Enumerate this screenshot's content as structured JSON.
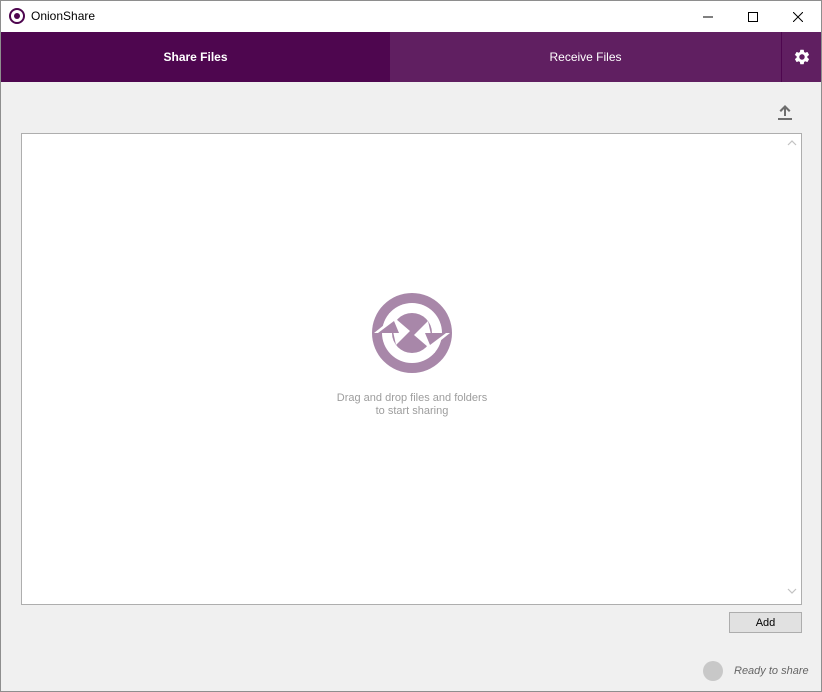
{
  "window": {
    "title": "OnionShare",
    "controls": [
      "minimize-icon",
      "maximize-icon",
      "close-icon"
    ]
  },
  "tabs": [
    {
      "label": "Share Files",
      "active": true
    },
    {
      "label": "Receive Files",
      "active": false
    }
  ],
  "toolbar": {
    "settings_icon": "gear-icon",
    "upload_icon": "upload-icon"
  },
  "dropzone": {
    "line1": "Drag and drop files and folders",
    "line2": "to start sharing",
    "logo_icon": "onionshare-logo-icon"
  },
  "buttons": {
    "add_label": "Add"
  },
  "status": {
    "text": "Ready to share"
  },
  "colors": {
    "tab_active": "#4e064f",
    "tab_inactive": "#601f61",
    "logo": "#a887a9",
    "status_idle": "#c8c8c8"
  }
}
